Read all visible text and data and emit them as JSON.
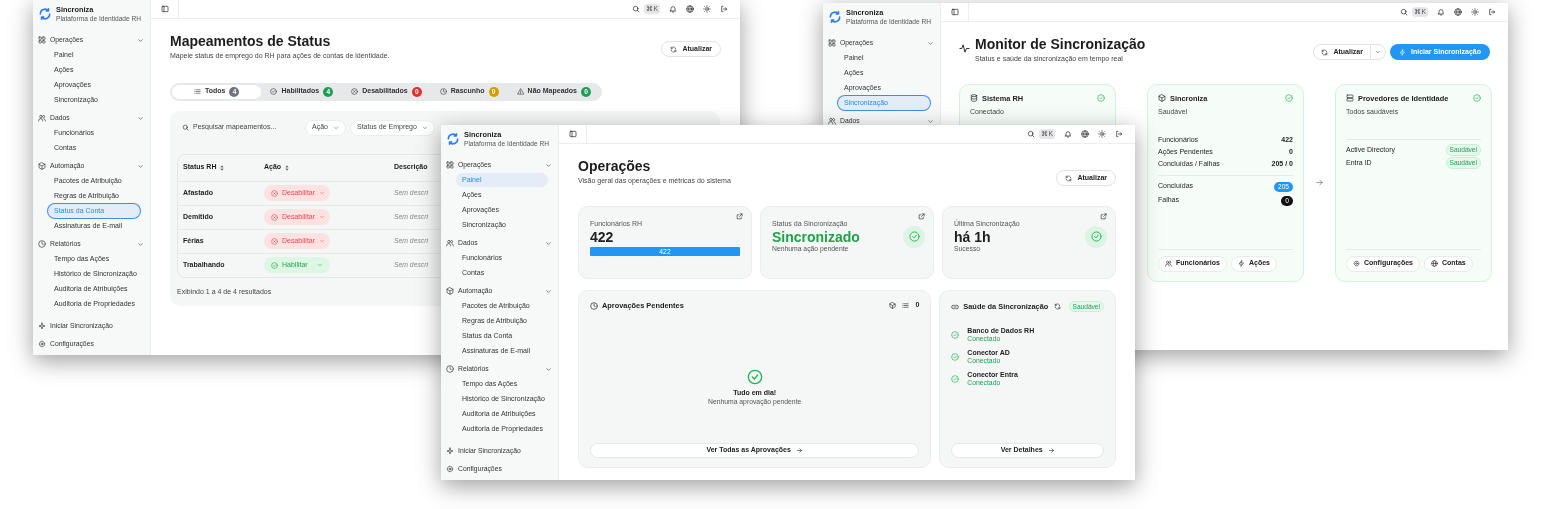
{
  "status_window": {
    "sidebar": {
      "brand": {
        "name": "Sincroniza",
        "tagline": "Plataforma de Identidade RH"
      },
      "focus_ring": true,
      "groups": [
        {
          "label": "Operações",
          "expanded": true,
          "items": [
            {
              "label": "Painel",
              "selected": false
            },
            {
              "label": "Ações",
              "selected": false
            },
            {
              "label": "Aprovações",
              "selected": false
            },
            {
              "label": "Sincronização",
              "selected": false
            }
          ]
        },
        {
          "label": "Dados",
          "expanded": true,
          "items": [
            {
              "label": "Funcionários",
              "selected": false
            },
            {
              "label": "Contas",
              "selected": false
            }
          ]
        },
        {
          "label": "Automação",
          "expanded": true,
          "items": [
            {
              "label": "Pacotes de Atribuição",
              "selected": false
            },
            {
              "label": "Regras de Atribuição",
              "selected": false
            },
            {
              "label": "Status da Conta",
              "selected": true
            },
            {
              "label": "Assinaturas de E-mail",
              "selected": false
            }
          ]
        },
        {
          "label": "Relatórios",
          "expanded": true,
          "items": [
            {
              "label": "Tempo das Ações",
              "selected": false
            },
            {
              "label": "Histórico de Sincronização",
              "selected": false
            },
            {
              "label": "Auditoria de Atribuições",
              "selected": false
            },
            {
              "label": "Auditoria de Propriedades",
              "selected": false
            }
          ]
        }
      ],
      "footer": [
        {
          "label": "Iniciar Sincronização"
        },
        {
          "label": "Configurações"
        }
      ]
    },
    "topbar": {
      "shortcut": "⌘K"
    },
    "title": "Mapeamentos de Status",
    "subtitle": "Mapeie status de emprego do RH para ações de contas de identidade.",
    "refresh_button": "Atualizar",
    "tabs": [
      {
        "label": "Todos",
        "count": "4",
        "color": "#6c757d",
        "selected": true
      },
      {
        "label": "Habilitados",
        "count": "4",
        "color": "#1f9d55",
        "selected": false
      },
      {
        "label": "Desabilitados",
        "count": "0",
        "color": "#e03131",
        "selected": false
      },
      {
        "label": "Rascunho",
        "count": "0",
        "color": "#d99a00",
        "selected": false
      },
      {
        "label": "Não Mapeados",
        "count": "0",
        "color": "#1f9d55",
        "selected": false
      }
    ],
    "search": {
      "placeholder": "Pesquisar mapeamentos..."
    },
    "filters": [
      "Ação",
      "Status de Emprego"
    ],
    "table": {
      "columns": [
        "Status RH",
        "Ação",
        "Descrição"
      ],
      "rows": [
        {
          "status": "Afastado",
          "action": {
            "kind": "disable",
            "label": "Desabilitar"
          },
          "description": "Sem descri"
        },
        {
          "status": "Demitido",
          "action": {
            "kind": "disable",
            "label": "Desabilitar"
          },
          "description": "Sem descri"
        },
        {
          "status": "Férias",
          "action": {
            "kind": "disable",
            "label": "Desabilitar"
          },
          "description": "Sem descri"
        },
        {
          "status": "Trabalhando",
          "action": {
            "kind": "enable",
            "label": "Habilitar"
          },
          "description": "Sem descri"
        }
      ]
    },
    "footer": "Exibindo 1 a 4 de 4 resultados"
  },
  "monitor_window": {
    "sidebar": {
      "brand": {
        "name": "Sincroniza",
        "tagline": "Plataforma de Identidade RH"
      },
      "focus_ring": true,
      "groups": [
        {
          "label": "Operações",
          "expanded": true,
          "items": [
            {
              "label": "Painel",
              "selected": false
            },
            {
              "label": "Ações",
              "selected": false
            },
            {
              "label": "Aprovações",
              "selected": false
            },
            {
              "label": "Sincronização",
              "selected": true
            }
          ]
        },
        {
          "label": "Dados",
          "expanded": true
        }
      ]
    },
    "topbar": {
      "shortcut": "⌘K"
    },
    "title": "Monitor de Sincronização",
    "subtitle": "Status e saúde da sincronização em tempo real",
    "refresh_button": "Atualizar",
    "start_button": "Iniciar Sincronização",
    "cards": [
      {
        "kind": "source",
        "title": "Sistema RH",
        "status": "Conectado",
        "healthy": true
      },
      {
        "kind": "hub",
        "title": "Sincroniza",
        "status": "Saudável",
        "healthy": true,
        "stats": [
          {
            "label": "Funcionários",
            "value": "422"
          },
          {
            "label": "Ações Pendentes",
            "value": "0"
          },
          {
            "label": "Concluídas / Falhas",
            "value": "205 / 0"
          }
        ],
        "counters": [
          {
            "label": "Concluídas",
            "value": "205",
            "color": "#2196f3"
          },
          {
            "label": "Falhas",
            "value": "0",
            "color": "#111111"
          }
        ],
        "links": [
          "Funcionários",
          "Ações"
        ]
      },
      {
        "kind": "providers",
        "title": "Provedores de Identidade",
        "status": "Todos saudáveis",
        "healthy": true,
        "providers": [
          {
            "name": "Active Directory",
            "status": "Saudável"
          },
          {
            "name": "Entra ID",
            "status": "Saudável"
          }
        ],
        "links": [
          "Configurações",
          "Contas"
        ]
      }
    ]
  },
  "operations_window": {
    "sidebar": {
      "brand": {
        "name": "Sincroniza",
        "tagline": "Plataforma de Identidade RH"
      },
      "focus_ring": false,
      "groups": [
        {
          "label": "Operações",
          "expanded": true,
          "items": [
            {
              "label": "Painel",
              "selected": true
            },
            {
              "label": "Ações",
              "selected": false
            },
            {
              "label": "Aprovações",
              "selected": false
            },
            {
              "label": "Sincronização",
              "selected": false
            }
          ]
        },
        {
          "label": "Dados",
          "expanded": true,
          "items": [
            {
              "label": "Funcionários",
              "selected": false
            },
            {
              "label": "Contas",
              "selected": false
            }
          ]
        },
        {
          "label": "Automação",
          "expanded": true,
          "items": [
            {
              "label": "Pacotes de Atribuição",
              "selected": false
            },
            {
              "label": "Regras de Atribuição",
              "selected": false
            },
            {
              "label": "Status da Conta",
              "selected": false
            },
            {
              "label": "Assinaturas de E-mail",
              "selected": false
            }
          ]
        },
        {
          "label": "Relatórios",
          "expanded": true,
          "items": [
            {
              "label": "Tempo das Ações",
              "selected": false
            },
            {
              "label": "Histórico de Sincronização",
              "selected": false
            },
            {
              "label": "Auditoria de Atribuições",
              "selected": false
            },
            {
              "label": "Auditoria de Propriedades",
              "selected": false
            }
          ]
        }
      ],
      "footer": [
        {
          "label": "Iniciar Sincronização"
        },
        {
          "label": "Configurações"
        }
      ]
    },
    "topbar": {
      "shortcut": "⌘K"
    },
    "title": "Operações",
    "subtitle": "Visão geral das operações e métricas do sistema",
    "refresh_button": "Atualizar",
    "stats": [
      {
        "kind": "meter",
        "label": "Funcionários RH",
        "value": "422",
        "level": 1,
        "bar_label": "422"
      },
      {
        "kind": "status",
        "label": "Status da Sincronização",
        "value": "Sincronizado",
        "highlight": true,
        "note": "Nenhuma ação pendente",
        "healthy": true
      },
      {
        "kind": "status",
        "label": "Última Sincronização",
        "value": "há 1h",
        "highlight": false,
        "note": "Sucesso",
        "healthy": true
      }
    ],
    "approvals": {
      "title": "Aprovações Pendentes",
      "count": "0",
      "empty_title": "Tudo em dia!",
      "empty_note": "Nenhuma aprovação pendente",
      "button": "Ver Todas as Aprovações"
    },
    "health": {
      "title": "Saúde da Sincronização",
      "badge": "Saudável",
      "items": [
        {
          "name": "Banco de Dados RH",
          "status": "Conectado",
          "healthy": true
        },
        {
          "name": "Conector AD",
          "status": "Conectado",
          "healthy": true
        },
        {
          "name": "Conector Entra",
          "status": "Conectado",
          "healthy": true
        }
      ],
      "button": "Ver Detalhes"
    }
  }
}
